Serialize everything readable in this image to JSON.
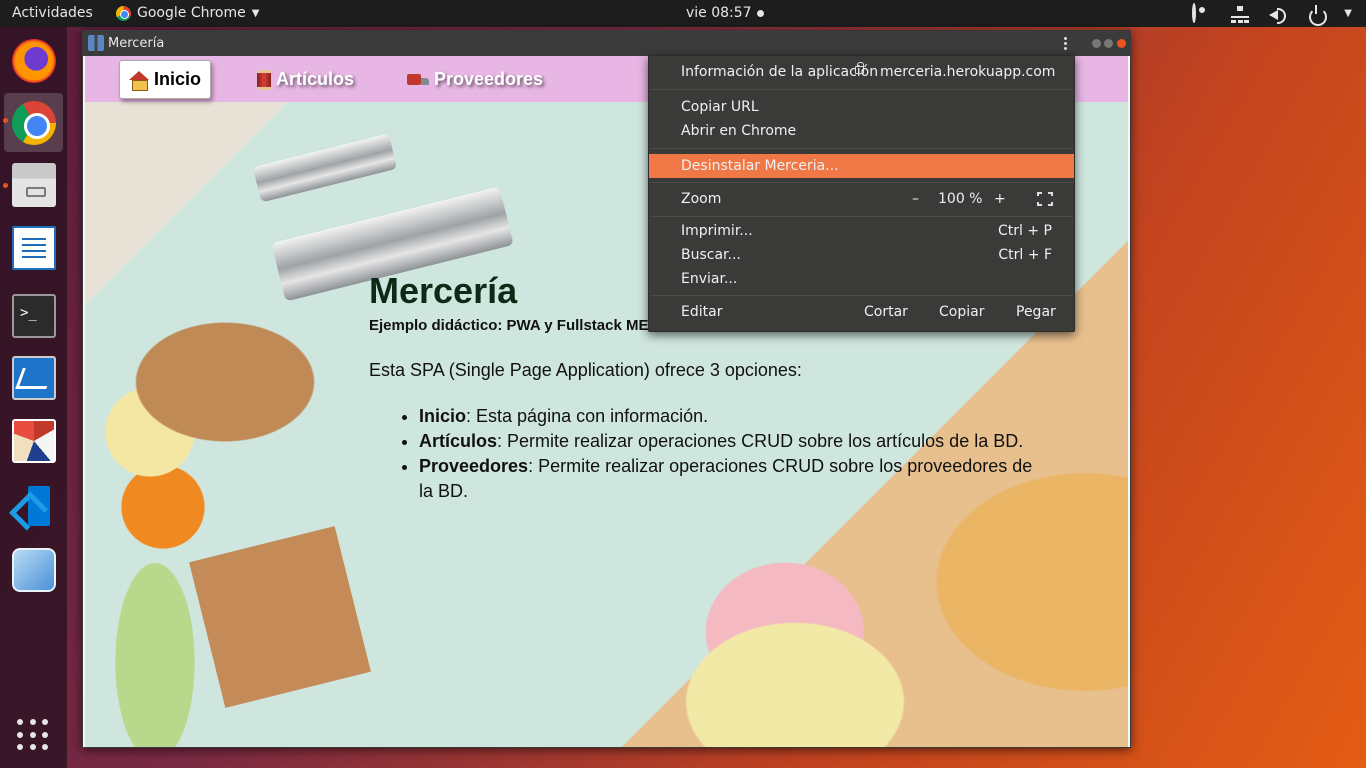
{
  "topbar": {
    "activities": "Actividades",
    "app_name": "Google Chrome",
    "clock": "vie 08:57"
  },
  "dock": {
    "items": [
      "firefox-icon",
      "chrome-icon",
      "files-icon",
      "writer-icon",
      "terminal-icon",
      "system-monitor-icon",
      "voronoi-app-icon",
      "vscode-icon",
      "virtualbox-icon"
    ],
    "terminal_glyph": ">_"
  },
  "window": {
    "title": "Mercería"
  },
  "nav": {
    "items": [
      {
        "label": "Inicio",
        "icon": "house-icon"
      },
      {
        "label": "Artículos",
        "icon": "spool-icon"
      },
      {
        "label": "Proveedores",
        "icon": "truck-icon"
      }
    ]
  },
  "content": {
    "heading": "Mercería",
    "subheading": "Ejemplo didáctico: PWA y Fullstack ME",
    "intro": "Esta SPA (Single Page Application) ofrece 3 opciones:",
    "options": [
      {
        "name": "Inicio",
        "text": ": Esta página con información."
      },
      {
        "name": "Artículos",
        "text": ": Permite realizar operaciones CRUD sobre los artículos de la BD."
      },
      {
        "name": "Proveedores",
        "text": ": Permite realizar operaciones CRUD sobre los proveedores de la BD."
      }
    ]
  },
  "menu": {
    "app_info": "Información de la aplicación",
    "url": "merceria.herokuapp.com",
    "copy_url": "Copiar URL",
    "open_in_chrome": "Abrir en Chrome",
    "uninstall": "Desinstalar Merceria...",
    "zoom_label": "Zoom",
    "zoom_minus": "–",
    "zoom_value": "100 %",
    "zoom_plus": "+",
    "print": "Imprimir...",
    "print_shortcut": "Ctrl + P",
    "find": "Buscar...",
    "find_shortcut": "Ctrl + F",
    "send": "Enviar...",
    "edit_label": "Editar",
    "cut": "Cortar",
    "copy": "Copiar",
    "paste": "Pegar"
  },
  "colors": {
    "menu_highlight": "#f07746",
    "navbar": "#e8b6e4",
    "topbar": "#1d1d1d"
  }
}
